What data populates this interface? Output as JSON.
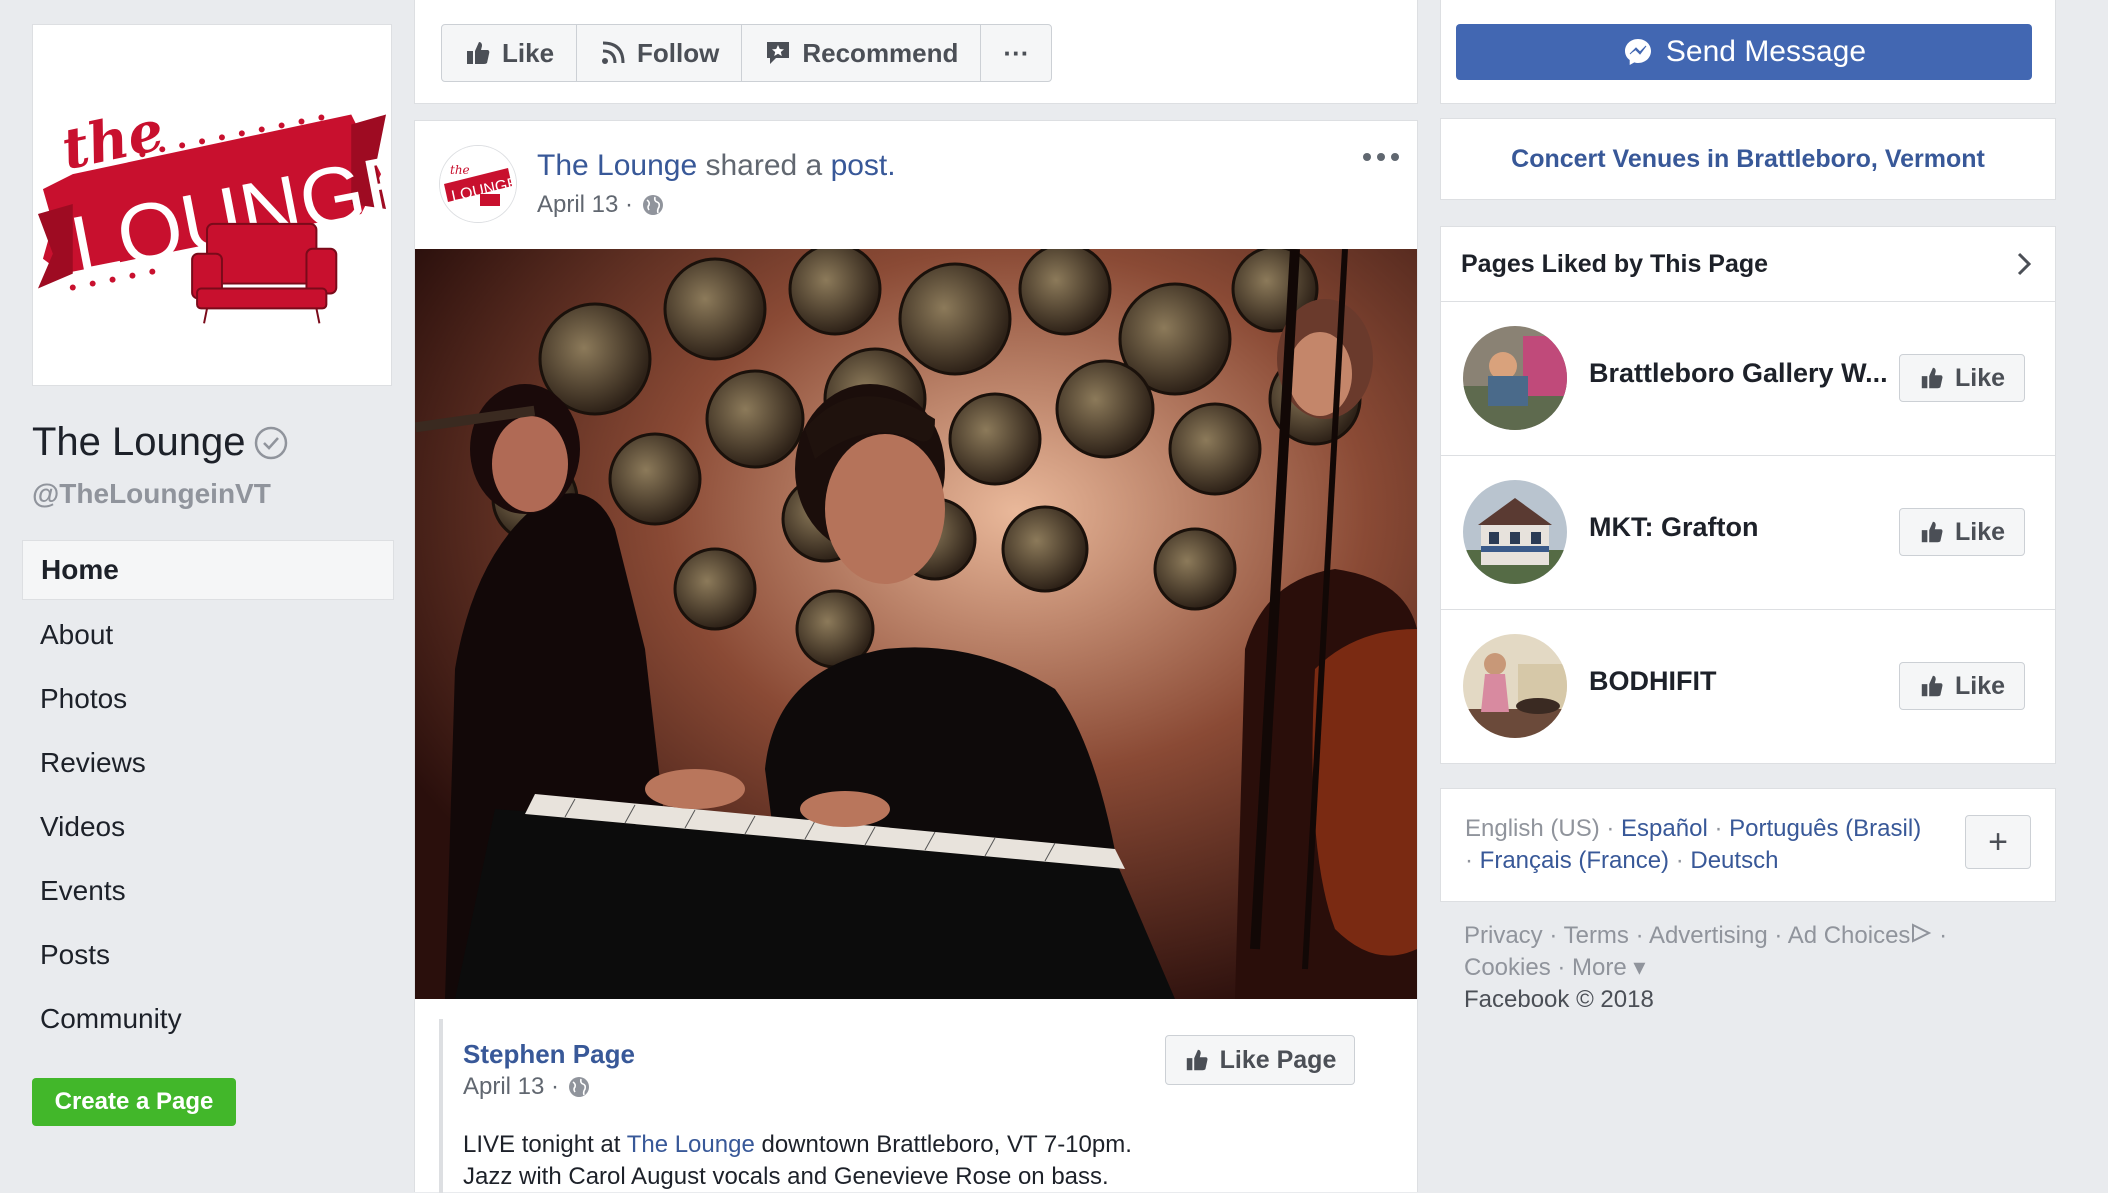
{
  "left": {
    "logo": {
      "text_the": "the",
      "text_lounge": "LOUNGE",
      "brand_color": "#c8102e"
    },
    "page_name": "The Lounge",
    "handle": "@TheLoungeinVT",
    "nav": [
      {
        "label": "Home",
        "active": true
      },
      {
        "label": "About"
      },
      {
        "label": "Photos"
      },
      {
        "label": "Reviews"
      },
      {
        "label": "Videos"
      },
      {
        "label": "Events"
      },
      {
        "label": "Posts"
      },
      {
        "label": "Community"
      }
    ],
    "create_page_label": "Create a Page"
  },
  "action_bar": {
    "like_label": "Like",
    "follow_label": "Follow",
    "recommend_label": "Recommend",
    "more_label": "···"
  },
  "post": {
    "author": "The Lounge",
    "shared_text": " shared a ",
    "post_link": "post.",
    "date": "April 13 ·",
    "shared": {
      "author": "Stephen Page",
      "date": "April 13 ·",
      "like_page_label": "Like Page",
      "text_prefix": "LIVE tonight at ",
      "text_link": "The Lounge",
      "text_suffix": " downtown Brattleboro, VT 7-10pm.",
      "text_line2": "Jazz with Carol August vocals and Genevieve Rose on bass."
    }
  },
  "right": {
    "send_message_label": "Send Message",
    "venue_link": "Concert Venues in Brattleboro, Vermont",
    "pages_liked_title": "Pages Liked by This Page",
    "pages_liked": [
      {
        "name": "Brattleboro Gallery W...",
        "like_label": "Like"
      },
      {
        "name": "MKT: Grafton",
        "like_label": "Like"
      },
      {
        "name": "BODHIFIT",
        "like_label": "Like"
      }
    ],
    "languages": {
      "current": "English (US)",
      "sep": " · ",
      "es": "Español",
      "pt": "Português (Brasil)",
      "fr": "Français (France)",
      "de": "Deutsch",
      "add_label": "+"
    },
    "footer": {
      "privacy": "Privacy",
      "terms": "Terms",
      "advertising": "Advertising",
      "ad_choices": "Ad Choices",
      "cookies": "Cookies",
      "more": "More",
      "copyright": "Facebook © 2018"
    }
  },
  "colors": {
    "background": "#e9ebee",
    "link": "#385898",
    "primary_button": "#4267b2",
    "create_button": "#42b72a"
  }
}
